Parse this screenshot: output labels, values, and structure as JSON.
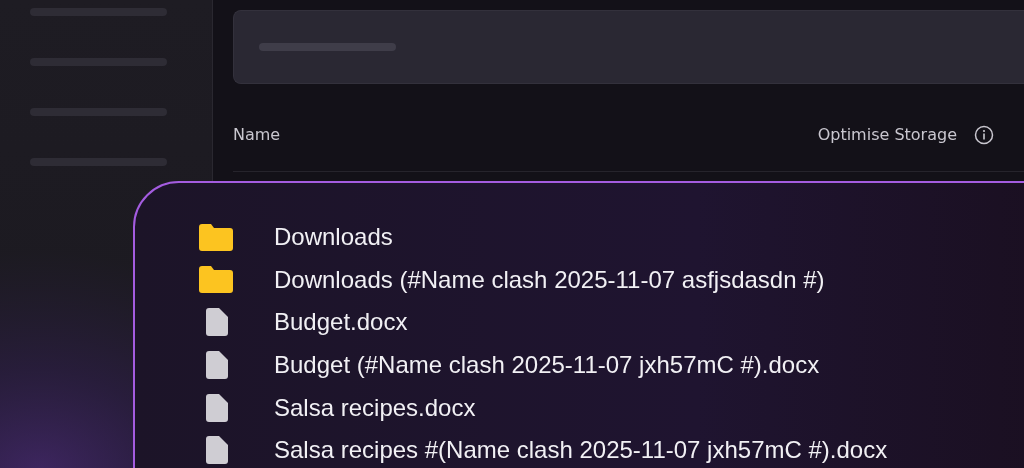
{
  "table": {
    "columns": [
      {
        "label": "Name"
      },
      {
        "label": "Optimise Storage"
      }
    ]
  },
  "files": [
    {
      "kind": "folder",
      "name": "Downloads"
    },
    {
      "kind": "folder",
      "name": "Downloads (#Name clash 2025-11-07 asfjsdasdn #)"
    },
    {
      "kind": "document",
      "name": "Budget.docx"
    },
    {
      "kind": "document",
      "name": "Budget (#Name clash 2025-11-07 jxh57mC #).docx"
    },
    {
      "kind": "document",
      "name": "Salsa recipes.docx"
    },
    {
      "kind": "document",
      "name": "Salsa recipes #(Name clash 2025-11-07 jxh57mC #).docx"
    }
  ]
}
